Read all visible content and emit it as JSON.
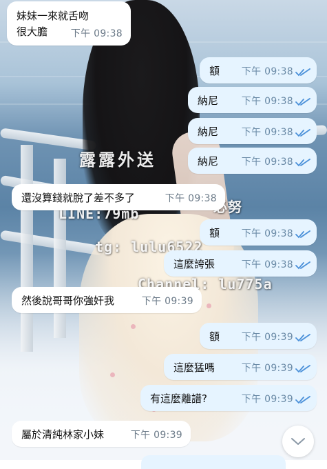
{
  "watermark": {
    "brand": "露露外送",
    "line": "LINE:79mb",
    "tg": "tg: lulu6522",
    "channel": "Channel: lu775a",
    "extra": "必努"
  },
  "messages": [
    {
      "direction": "in",
      "text": "妹妹一來就舌吻",
      "text2": "很大膽",
      "time": "下午 09:38"
    },
    {
      "direction": "out",
      "text": "額",
      "time": "下午 09:38",
      "read": true
    },
    {
      "direction": "out",
      "text": "納尼",
      "time": "下午 09:38",
      "read": true
    },
    {
      "direction": "out",
      "text": "納尼",
      "time": "下午 09:38",
      "read": true
    },
    {
      "direction": "out",
      "text": "納尼",
      "time": "下午 09:38",
      "read": true
    },
    {
      "direction": "in",
      "text": "還沒算錢就脫了差不多了",
      "time": "下午 09:38"
    },
    {
      "direction": "out",
      "text": "額",
      "time": "下午 09:38",
      "read": true
    },
    {
      "direction": "out",
      "text": "這麼誇張",
      "time": "下午 09:38",
      "read": true
    },
    {
      "direction": "in",
      "text": "然後說哥哥你強奸我",
      "time": "下午 09:39"
    },
    {
      "direction": "out",
      "text": "額",
      "time": "下午 09:39",
      "read": true
    },
    {
      "direction": "out",
      "text": "這麼猛嗎",
      "time": "下午 09:39",
      "read": true
    },
    {
      "direction": "out",
      "text": "有這麼離譜?",
      "time": "下午 09:39",
      "read": true
    },
    {
      "direction": "in",
      "text": "屬於清純林家小妹",
      "time": "下午 09:39"
    }
  ],
  "icons": {
    "read_receipt": "double-check-icon",
    "scroll_down": "chevron-down-icon"
  },
  "colors": {
    "incoming_bubble": "#ffffff",
    "outgoing_bubble": "#e6f4ff",
    "check": "#4a90d9"
  }
}
